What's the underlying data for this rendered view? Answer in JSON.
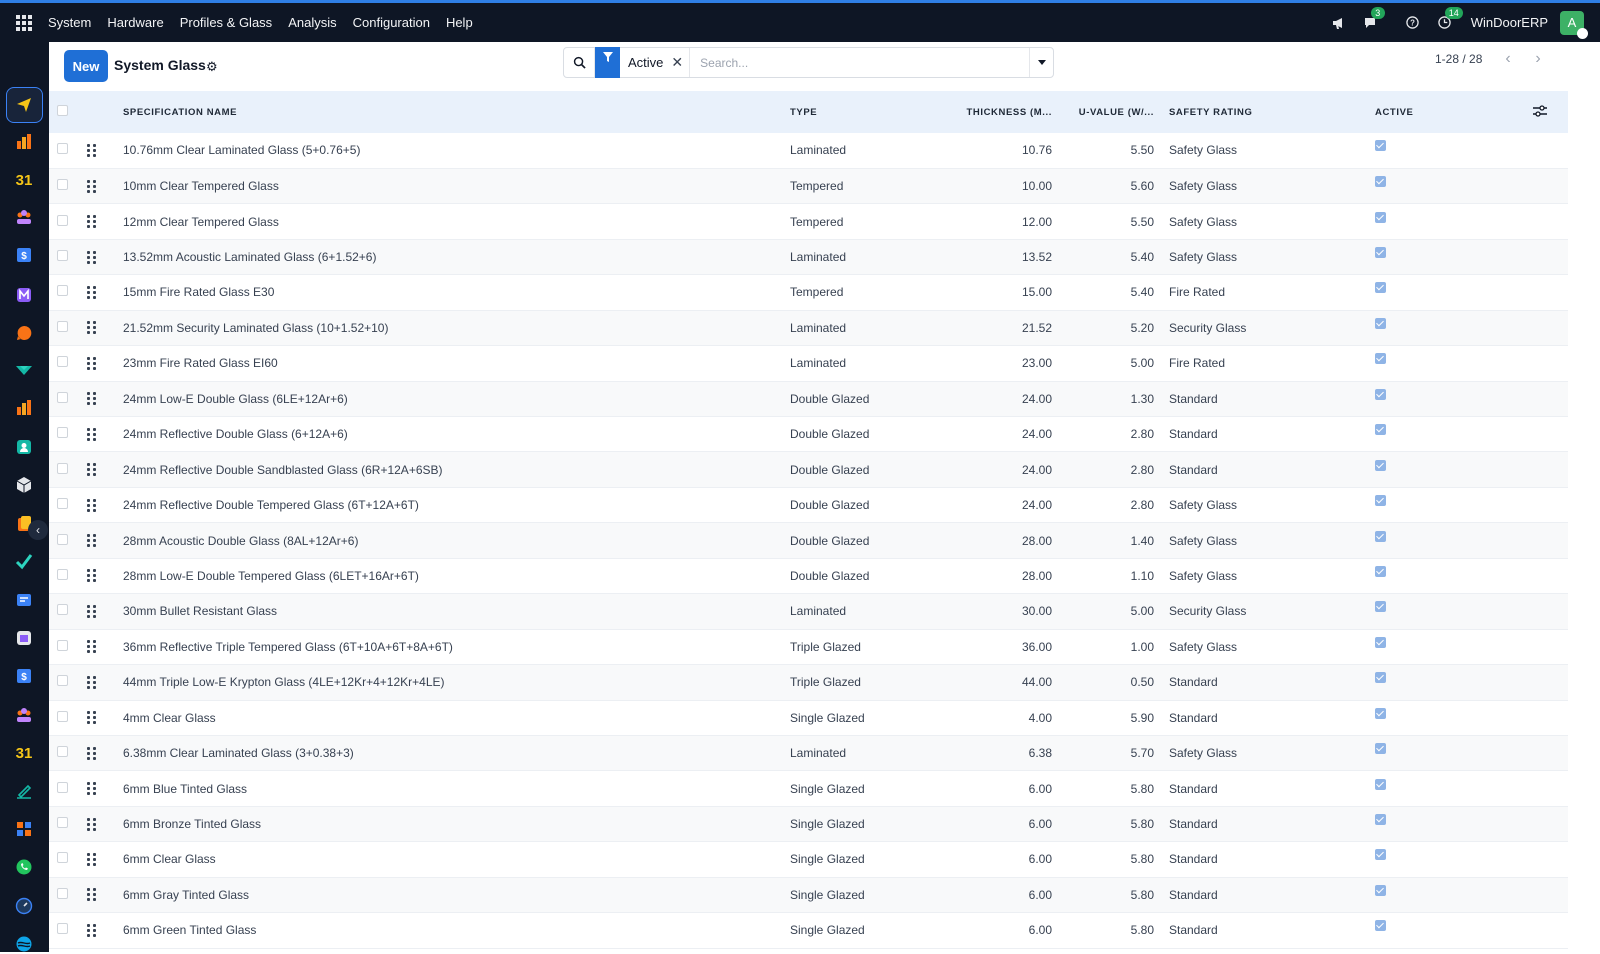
{
  "topbar": {
    "menu": [
      "System",
      "Hardware",
      "Profiles & Glass",
      "Analysis",
      "Configuration",
      "Help"
    ],
    "messages_count": "3",
    "activities_count": "14",
    "company": "WinDoorERP",
    "avatar_letter": "A"
  },
  "sidebar": {
    "apps": [
      "discuss-icon",
      "dashboard-icon",
      "calendar-icon",
      "contacts-icon",
      "sales-icon",
      "email-marketing-icon",
      "live-chat-icon",
      "website-icon",
      "reporting-icon",
      "employees-icon",
      "inventory-icon",
      "documents-icon",
      "project-icon",
      "knowledge-icon",
      "purchase-icon",
      "invoicing-icon",
      "crm-icon",
      "calendar-2-icon",
      "sign-icon",
      "apps-dashboard-icon",
      "whatsapp-icon",
      "planning-icon",
      "helpdesk-icon"
    ]
  },
  "control": {
    "new_label": "New",
    "title": "System Glass",
    "facet": "Active",
    "search_placeholder": "Search...",
    "pager": "1-28 / 28"
  },
  "table": {
    "columns": [
      "Specification Name",
      "Type",
      "Thickness (m...",
      "U-Value (W/...",
      "Safety Rating",
      "Active"
    ],
    "rows": [
      {
        "name": "10.76mm Clear Laminated Glass (5+0.76+5)",
        "type": "Laminated",
        "thickness": "10.76",
        "uvalue": "5.50",
        "rating": "Safety Glass",
        "active": true
      },
      {
        "name": "10mm Clear Tempered Glass",
        "type": "Tempered",
        "thickness": "10.00",
        "uvalue": "5.60",
        "rating": "Safety Glass",
        "active": true
      },
      {
        "name": "12mm Clear Tempered Glass",
        "type": "Tempered",
        "thickness": "12.00",
        "uvalue": "5.50",
        "rating": "Safety Glass",
        "active": true
      },
      {
        "name": "13.52mm Acoustic Laminated Glass (6+1.52+6)",
        "type": "Laminated",
        "thickness": "13.52",
        "uvalue": "5.40",
        "rating": "Safety Glass",
        "active": true
      },
      {
        "name": "15mm Fire Rated Glass E30",
        "type": "Tempered",
        "thickness": "15.00",
        "uvalue": "5.40",
        "rating": "Fire Rated",
        "active": true
      },
      {
        "name": "21.52mm Security Laminated Glass (10+1.52+10)",
        "type": "Laminated",
        "thickness": "21.52",
        "uvalue": "5.20",
        "rating": "Security Glass",
        "active": true
      },
      {
        "name": "23mm Fire Rated Glass EI60",
        "type": "Laminated",
        "thickness": "23.00",
        "uvalue": "5.00",
        "rating": "Fire Rated",
        "active": true
      },
      {
        "name": "24mm Low-E Double Glass (6LE+12Ar+6)",
        "type": "Double Glazed",
        "thickness": "24.00",
        "uvalue": "1.30",
        "rating": "Standard",
        "active": true
      },
      {
        "name": "24mm Reflective Double Glass (6+12A+6)",
        "type": "Double Glazed",
        "thickness": "24.00",
        "uvalue": "2.80",
        "rating": "Standard",
        "active": true
      },
      {
        "name": "24mm Reflective Double Sandblasted Glass (6R+12A+6SB)",
        "type": "Double Glazed",
        "thickness": "24.00",
        "uvalue": "2.80",
        "rating": "Standard",
        "active": true
      },
      {
        "name": "24mm Reflective Double Tempered Glass (6T+12A+6T)",
        "type": "Double Glazed",
        "thickness": "24.00",
        "uvalue": "2.80",
        "rating": "Safety Glass",
        "active": true
      },
      {
        "name": "28mm Acoustic Double Glass (8AL+12Ar+6)",
        "type": "Double Glazed",
        "thickness": "28.00",
        "uvalue": "1.40",
        "rating": "Safety Glass",
        "active": true
      },
      {
        "name": "28mm Low-E Double Tempered Glass (6LET+16Ar+6T)",
        "type": "Double Glazed",
        "thickness": "28.00",
        "uvalue": "1.10",
        "rating": "Safety Glass",
        "active": true
      },
      {
        "name": "30mm Bullet Resistant Glass",
        "type": "Laminated",
        "thickness": "30.00",
        "uvalue": "5.00",
        "rating": "Security Glass",
        "active": true
      },
      {
        "name": "36mm Reflective Triple Tempered Glass (6T+10A+6T+8A+6T)",
        "type": "Triple Glazed",
        "thickness": "36.00",
        "uvalue": "1.00",
        "rating": "Safety Glass",
        "active": true
      },
      {
        "name": "44mm Triple Low-E Krypton Glass (4LE+12Kr+4+12Kr+4LE)",
        "type": "Triple Glazed",
        "thickness": "44.00",
        "uvalue": "0.50",
        "rating": "Standard",
        "active": true
      },
      {
        "name": "4mm Clear Glass",
        "type": "Single Glazed",
        "thickness": "4.00",
        "uvalue": "5.90",
        "rating": "Standard",
        "active": true
      },
      {
        "name": "6.38mm Clear Laminated Glass (3+0.38+3)",
        "type": "Laminated",
        "thickness": "6.38",
        "uvalue": "5.70",
        "rating": "Safety Glass",
        "active": true
      },
      {
        "name": "6mm Blue Tinted Glass",
        "type": "Single Glazed",
        "thickness": "6.00",
        "uvalue": "5.80",
        "rating": "Standard",
        "active": true
      },
      {
        "name": "6mm Bronze Tinted Glass",
        "type": "Single Glazed",
        "thickness": "6.00",
        "uvalue": "5.80",
        "rating": "Standard",
        "active": true
      },
      {
        "name": "6mm Clear Glass",
        "type": "Single Glazed",
        "thickness": "6.00",
        "uvalue": "5.80",
        "rating": "Standard",
        "active": true
      },
      {
        "name": "6mm Gray Tinted Glass",
        "type": "Single Glazed",
        "thickness": "6.00",
        "uvalue": "5.80",
        "rating": "Standard",
        "active": true
      },
      {
        "name": "6mm Green Tinted Glass",
        "type": "Single Glazed",
        "thickness": "6.00",
        "uvalue": "5.80",
        "rating": "Standard",
        "active": true
      }
    ]
  },
  "colors": {
    "accent": "#1f6fd6",
    "navbar": "#0e1625",
    "header_row": "#e9f1fb",
    "badge": "#22a55a"
  }
}
